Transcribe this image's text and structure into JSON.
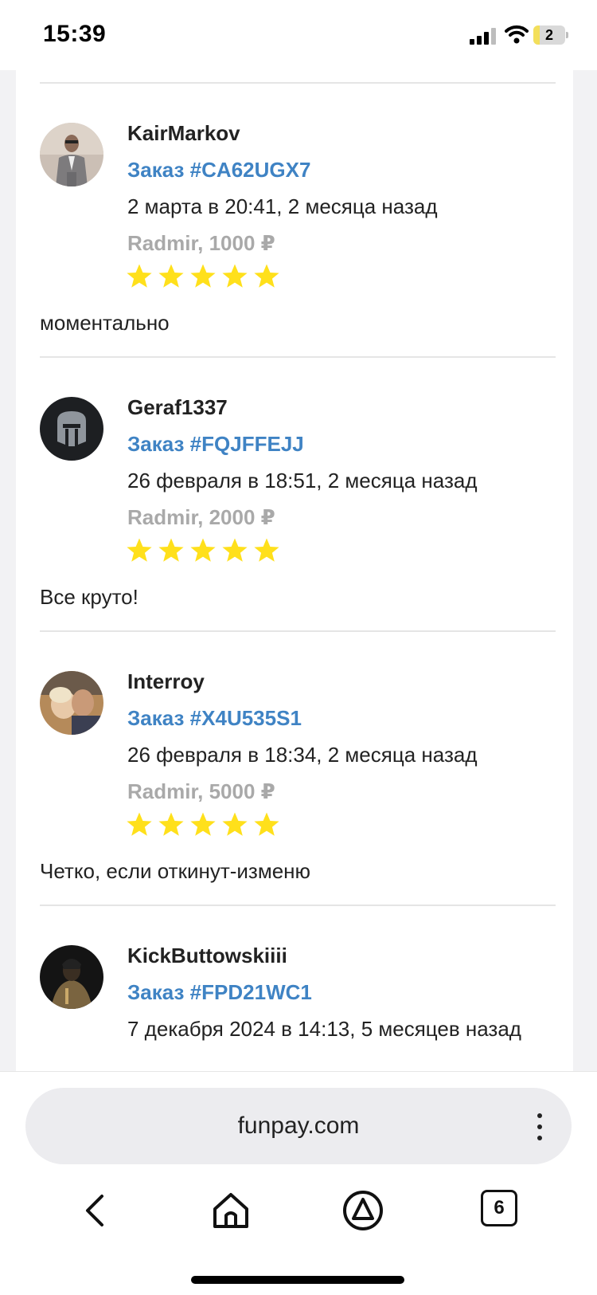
{
  "status_bar": {
    "time": "15:39",
    "battery_level": "2",
    "icons": [
      "cellular-signal-icon",
      "wifi-icon",
      "battery-icon"
    ]
  },
  "reviews": [
    {
      "username": "KairMarkov",
      "order": "Заказ #CA62UGX7",
      "date": "2 марта в 20:41, 2 месяца назад",
      "seller_amount": "Radmir, 1000 ₽",
      "rating": 5,
      "text": "моментально",
      "avatar": "user-photo"
    },
    {
      "username": "Geraf1337",
      "order": "Заказ #FQJFFEJJ",
      "date": "26 февраля в 18:51, 2 месяца назад",
      "seller_amount": "Radmir, 2000 ₽",
      "rating": 5,
      "text": "Все круто!",
      "avatar": "spartan-helmet-icon"
    },
    {
      "username": "Interroy",
      "order": "Заказ #X4U535S1",
      "date": "26 февраля в 18:34, 2 месяца назад",
      "seller_amount": "Radmir, 5000 ₽",
      "rating": 5,
      "text": "Четко, если откинут-изменю",
      "avatar": "user-photo"
    },
    {
      "username": "KickButtowskiiii",
      "order": "Заказ #FPD21WC1",
      "date": "7 декабря 2024 в 14:13, 5 месяцев назад",
      "seller_amount": "",
      "rating": 0,
      "text": "",
      "avatar": "dark-character-image"
    }
  ],
  "browser": {
    "url": "funpay.com",
    "tab_count": "6",
    "nav_icons": [
      "back-arrow-icon",
      "home-icon",
      "alice-assistant-icon",
      "tabs-icon",
      "more-menu-icon"
    ]
  },
  "colors": {
    "order_link": "#3f83c4",
    "seller_gray": "#a9a9a9",
    "star_yellow": "#ffe01b"
  }
}
